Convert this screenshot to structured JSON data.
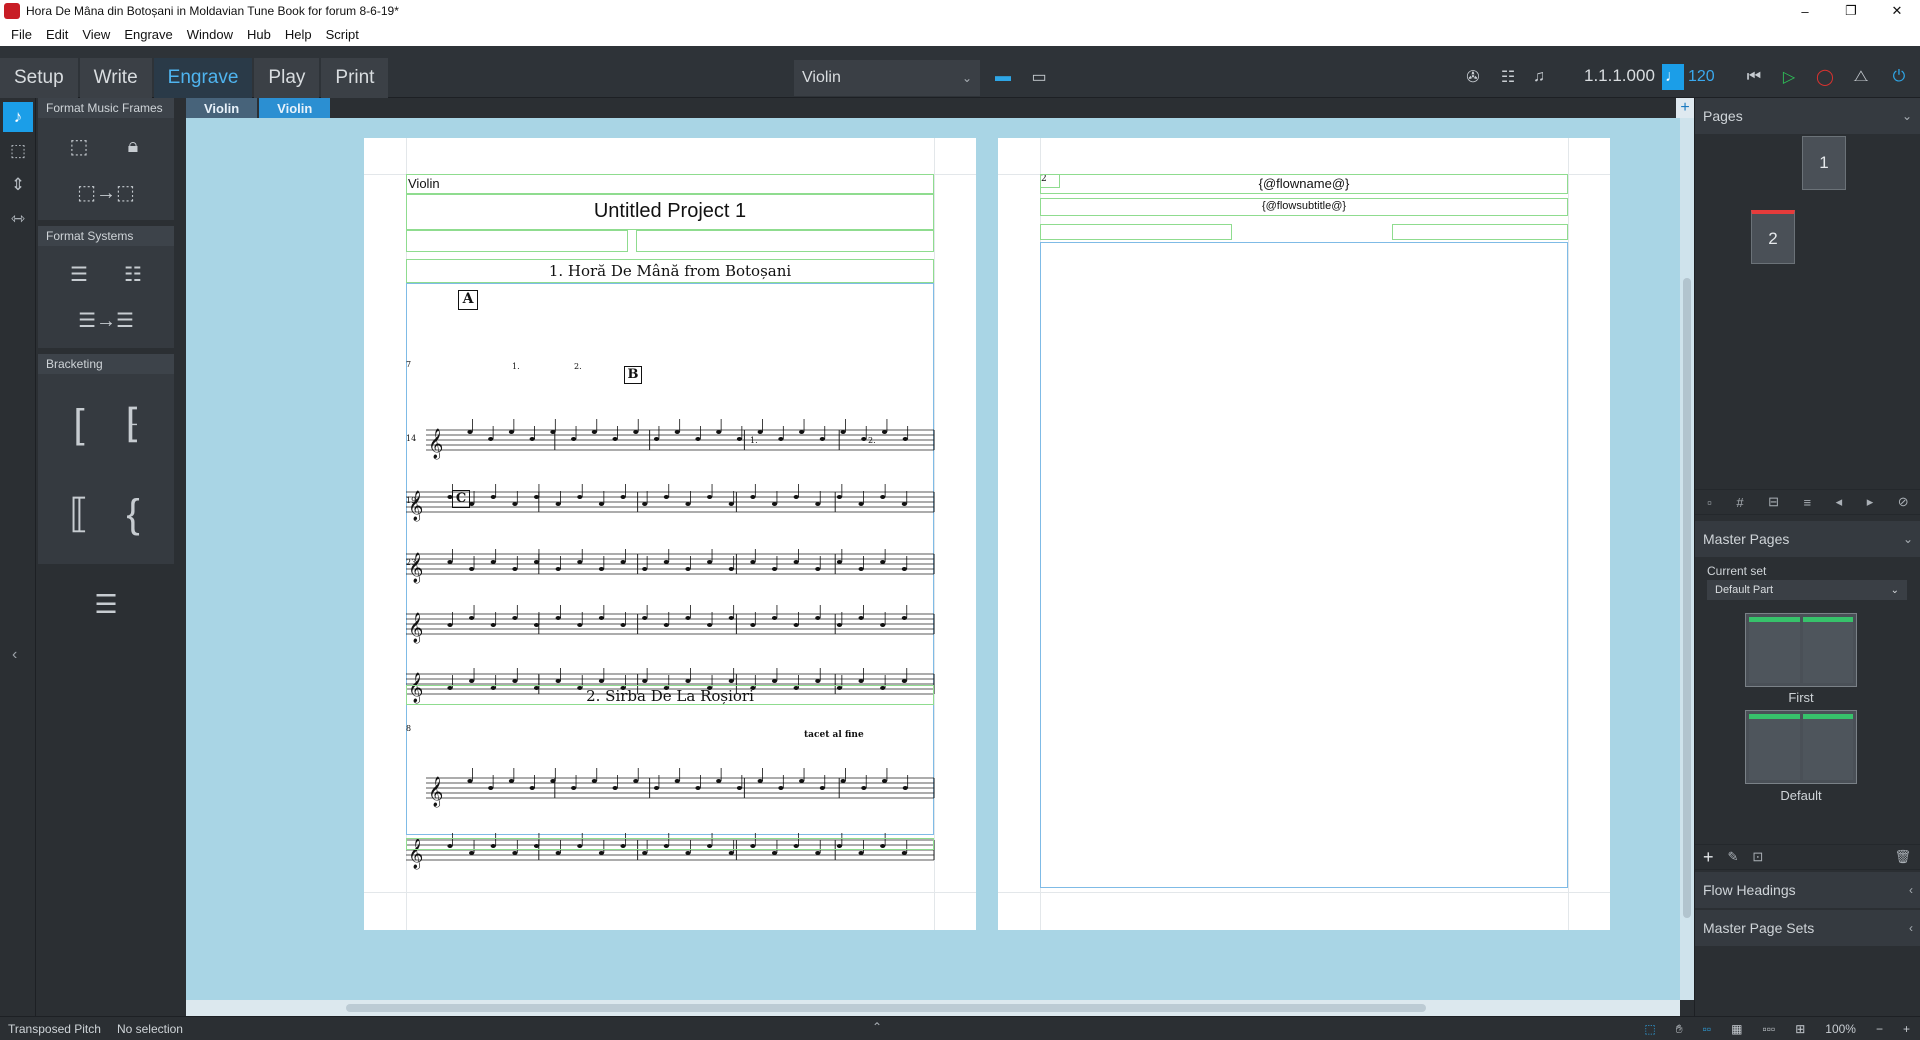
{
  "window": {
    "title": "Hora De Mâna din Botoșani in Moldavian Tune Book for forum 8-6-19*",
    "controls": [
      "–",
      "❐",
      "✕"
    ]
  },
  "menu": [
    "File",
    "Edit",
    "View",
    "Engrave",
    "Window",
    "Hub",
    "Help",
    "Script"
  ],
  "modes": [
    {
      "label": "Setup",
      "active": false
    },
    {
      "label": "Write",
      "active": false
    },
    {
      "label": "Engrave",
      "active": true
    },
    {
      "label": "Play",
      "active": false
    },
    {
      "label": "Print",
      "active": false
    }
  ],
  "layout_selector": {
    "value": "Violin"
  },
  "transport": {
    "position": "1.1.1.000",
    "tempo": "120"
  },
  "left_panel": {
    "groups": [
      "Format Music Frames",
      "Format Systems",
      "Bracketing"
    ]
  },
  "tabs": [
    "Violin",
    "Violin"
  ],
  "score": {
    "page1": {
      "part_name": "Violin",
      "project_title": "Untitled Project 1",
      "flow1_title": "1. Horă De Mână from Botoșani",
      "flow2_title": "2. Sirba De La Roșiori",
      "rehearsal_marks": [
        "A",
        "B",
        "C"
      ],
      "measure_numbers": [
        "7",
        "14",
        "19",
        "23",
        "8"
      ],
      "endings": [
        "1.",
        "2.",
        "1.",
        "2."
      ],
      "expression": "tacet al fine"
    },
    "page2": {
      "page_number": "2",
      "flowname": "{@flowname@}",
      "flowsubtitle": "{@flowsubtitle@}"
    }
  },
  "right_panel": {
    "pages_heading": "Pages",
    "pages": [
      "1",
      "2"
    ],
    "master_pages_heading": "Master Pages",
    "current_set_label": "Current set",
    "current_set_value": "Default Part",
    "master_pages": [
      "First",
      "Default"
    ],
    "flow_headings": "Flow Headings",
    "master_page_sets": "Master Page Sets"
  },
  "status": {
    "left1": "Transposed Pitch",
    "left2": "No selection",
    "zoom": "100%"
  }
}
